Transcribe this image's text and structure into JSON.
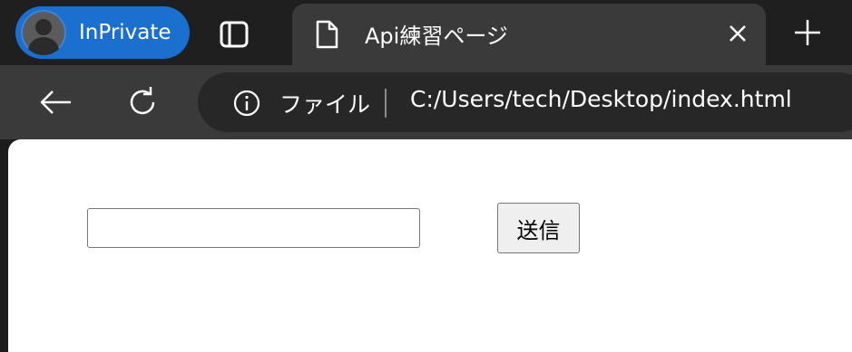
{
  "tabstrip": {
    "inprivate_label": "InPrivate",
    "active_tab": {
      "title": "Api練習ページ",
      "icon": "document-icon"
    }
  },
  "toolbar": {
    "site_info_label": "ファイル",
    "url": "C:/Users/tech/Desktop/index.html"
  },
  "page": {
    "input": {
      "value": "",
      "placeholder": ""
    },
    "send_button_label": "送信"
  },
  "colors": {
    "inprivate_accent": "#1a6fcf",
    "tabstrip_bg": "#1f1f1f",
    "toolbar_bg": "#3a3a3a",
    "omnibox_bg": "#272727",
    "page_bg": "#ffffff"
  }
}
